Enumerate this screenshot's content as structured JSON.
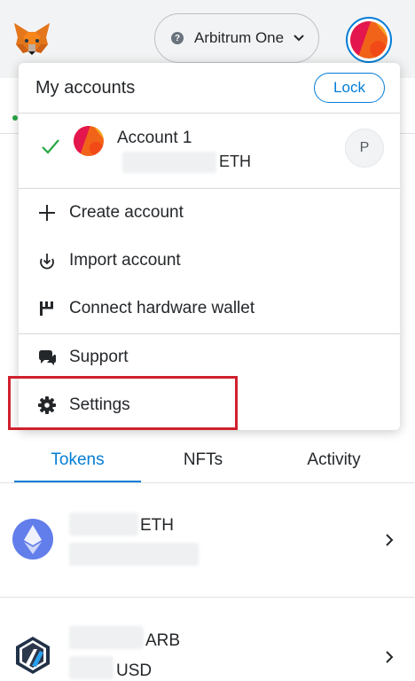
{
  "header": {
    "network": {
      "name": "Arbitrum One",
      "help_icon_text": "?"
    }
  },
  "menu": {
    "title": "My accounts",
    "lock_label": "Lock",
    "account": {
      "name": "Account 1",
      "balance_unit": "ETH",
      "badge": "P"
    },
    "items": [
      {
        "label": "Create account",
        "icon": "plus-icon"
      },
      {
        "label": "Import account",
        "icon": "import-icon"
      },
      {
        "label": "Connect hardware wallet",
        "icon": "hardware-wallet-icon"
      },
      {
        "label": "Support",
        "icon": "support-icon"
      },
      {
        "label": "Settings",
        "icon": "gear-icon"
      }
    ]
  },
  "tabs": [
    {
      "label": "Tokens",
      "active": true
    },
    {
      "label": "NFTs",
      "active": false
    },
    {
      "label": "Activity",
      "active": false
    }
  ],
  "assets": [
    {
      "symbol": "ETH",
      "sub": "",
      "icon": "ethereum-icon"
    },
    {
      "symbol": "ARB",
      "sub": "USD",
      "icon": "arbitrum-icon"
    }
  ],
  "colors": {
    "accent": "#037dd6",
    "highlight": "#d0202e",
    "check": "#28a745"
  }
}
